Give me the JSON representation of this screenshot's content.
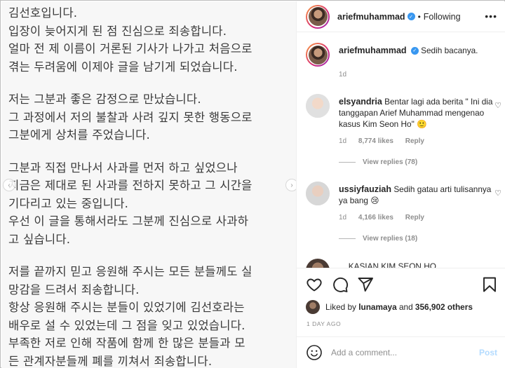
{
  "post_text": {
    "lines": [
      "김선호입니다.",
      "입장이 늦어지게 된 점 진심으로 죄송합니다.",
      "얼마 전 제 이름이 거론된 기사가 나가고 처음으로",
      "겪는 두려움에 이제야 글을 남기게 되었습니다.",
      "",
      "저는 그분과 좋은 감정으로 만났습니다.",
      "그 과정에서 저의 불찰과 사려 깊지 못한 행동으로",
      "그분에게 상처를 주었습니다.",
      "",
      "그분과 직접 만나서 사과를 먼저 하고 싶었으나",
      "지금은 제대로 된 사과를 전하지 못하고 그 시간을",
      "기다리고 있는 중입니다.",
      "우선 이 글을 통해서라도 그분께 진심으로 사과하",
      "고 싶습니다.",
      "",
      "저를 끝까지 믿고 응원해 주시는 모든 분들께도 실",
      "망감을 드려서 죄송합니다.",
      "항상 응원해 주시는 분들이 있었기에 김선호라는",
      "배우로 설 수 있었는데 그 점을 잊고 있었습니다.",
      "부족한 저로 인해 작품에 함께 한 많은 분들과 모",
      "든 관계자분들께 폐를 끼쳐서 죄송합니다."
    ]
  },
  "header": {
    "username": "ariefmuhammad",
    "separator": "•",
    "follow_status": "Following",
    "more_icon": "more-horizontal-icon"
  },
  "caption": {
    "username": "ariefmuhammad",
    "text": "Sedih bacanya.",
    "age": "1d"
  },
  "comments": [
    {
      "username": "elsyandria",
      "text": "Bentar lagi ada berita \" Ini dia tanggapan Arief Muhammad mengenao kasus Kim Seon Ho\" 🙂",
      "age": "1d",
      "likes": "8,774 likes",
      "reply_label": "Reply",
      "view_replies": "View replies (78)"
    },
    {
      "username": "ussiyfauziah",
      "text": "Sedih gatau arti tulisannya ya bang 😢",
      "age": "1d",
      "likes": "4,166 likes",
      "reply_label": "Reply",
      "view_replies": "View replies (18)"
    }
  ],
  "partial_comment": {
    "username": "...",
    "text": "KASIAN KIM SEON HO"
  },
  "likes_summary": {
    "prefix": "Liked by",
    "user": "lunamaya",
    "middle": "and",
    "count": "356,902 others"
  },
  "timestamp": "1 DAY AGO",
  "add_comment": {
    "placeholder": "Add a comment...",
    "post_label": "Post"
  },
  "colors": {
    "verified": "#3897f0",
    "post_button_disabled": "#b3dbff",
    "muted": "#8e8e8e"
  }
}
